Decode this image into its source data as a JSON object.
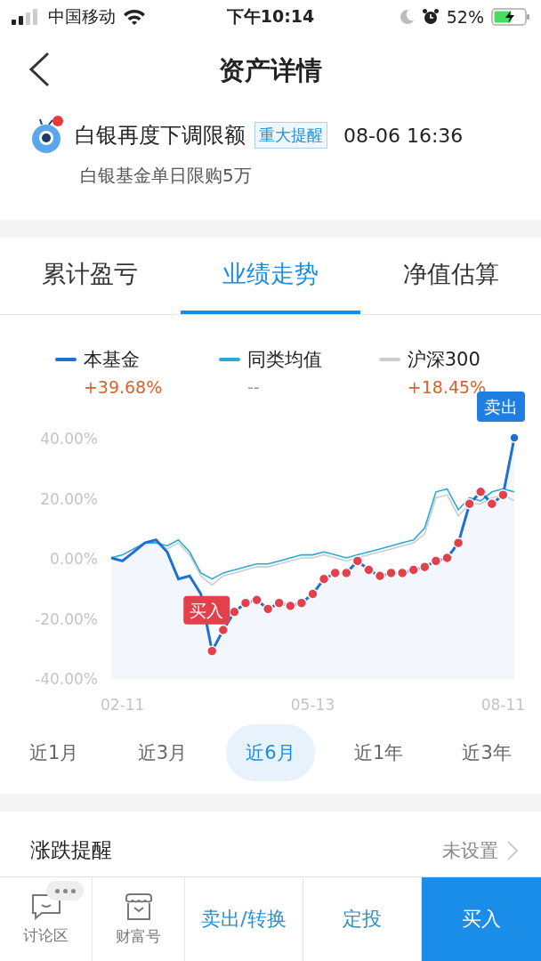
{
  "status_bar": {
    "carrier": "中国移动",
    "time": "下午10:14",
    "battery": "52%"
  },
  "nav": {
    "title": "资产详情"
  },
  "notice": {
    "unread": true,
    "title": "白银再度下调限额",
    "tag": "重大提醒",
    "time": "08-06 16:36",
    "body": "白银基金单日限购5万"
  },
  "tabs": [
    {
      "label": "累计盈亏",
      "selected": false
    },
    {
      "label": "业绩走势",
      "selected": true
    },
    {
      "label": "净值估算",
      "selected": false
    }
  ],
  "legend_values": [
    "+39.68%",
    "--",
    "+18.45%"
  ],
  "chart_data": {
    "type": "line",
    "ylim": [
      -40,
      40
    ],
    "categories": [
      null,
      "02-11",
      null,
      null,
      null,
      null,
      null,
      null,
      null,
      null,
      null,
      null,
      null,
      null,
      null,
      null,
      null,
      null,
      "05-13",
      null,
      null,
      null,
      null,
      null,
      null,
      null,
      null,
      null,
      null,
      null,
      null,
      null,
      null,
      null,
      null,
      "08-11",
      null
    ],
    "yticks": [
      {
        "value": 40,
        "label": "40.00%"
      },
      {
        "value": 20,
        "label": "20.00%"
      },
      {
        "value": 0,
        "label": "0.00%"
      },
      {
        "value": -20,
        "label": "-20.00%"
      },
      {
        "value": -40,
        "label": "-40.00%"
      }
    ],
    "series": [
      {
        "name": "本基金",
        "color": "#1f6fd1",
        "values": [
          0,
          -1,
          2,
          5,
          6,
          2,
          -7,
          -6,
          -12,
          -31,
          -24,
          -18,
          -15,
          -14,
          -17,
          -15,
          -16,
          -15,
          -12,
          -7,
          -5,
          -5,
          -1,
          -4,
          -6,
          -5,
          -5,
          -4,
          -3,
          -1,
          0,
          5,
          18,
          22,
          18,
          21,
          40
        ]
      },
      {
        "name": "同类均值",
        "color": "#29a9d6",
        "values": [
          0,
          1,
          3,
          5,
          5,
          4,
          6,
          2,
          -5,
          -7,
          -5,
          -4,
          -3,
          -2,
          -2,
          -1,
          0,
          1,
          1,
          2,
          1,
          0,
          1,
          2,
          3,
          4,
          5,
          6,
          10,
          22,
          23,
          16,
          20,
          19,
          22,
          23,
          22
        ]
      },
      {
        "name": "沪深300",
        "color": "#cccccc",
        "values": [
          0,
          1,
          3,
          5,
          5,
          3,
          5,
          1,
          -6,
          -9,
          -6,
          -5,
          -4,
          -3,
          -3,
          -2,
          -1,
          0,
          0,
          1,
          0,
          -1,
          0,
          1,
          2,
          3,
          4,
          5,
          8,
          20,
          21,
          14,
          18,
          18,
          20,
          21,
          19
        ]
      }
    ],
    "annotations": [
      "买入",
      "卖出"
    ]
  },
  "periods": [
    {
      "label": "近1月",
      "selected": false
    },
    {
      "label": "近3月",
      "selected": false
    },
    {
      "label": "近6月",
      "selected": true
    },
    {
      "label": "近1年",
      "selected": false
    },
    {
      "label": "近3年",
      "selected": false
    }
  ],
  "alert_row": {
    "label": "涨跌提醒",
    "value": "未设置"
  },
  "bottom_bar": [
    {
      "kind": "chat",
      "label": "讨论区"
    },
    {
      "kind": "shop",
      "label": "财富号"
    },
    {
      "kind": "text",
      "label": "卖出/转换"
    },
    {
      "kind": "text",
      "label": "定投"
    },
    {
      "kind": "primary",
      "label": "买入"
    }
  ]
}
